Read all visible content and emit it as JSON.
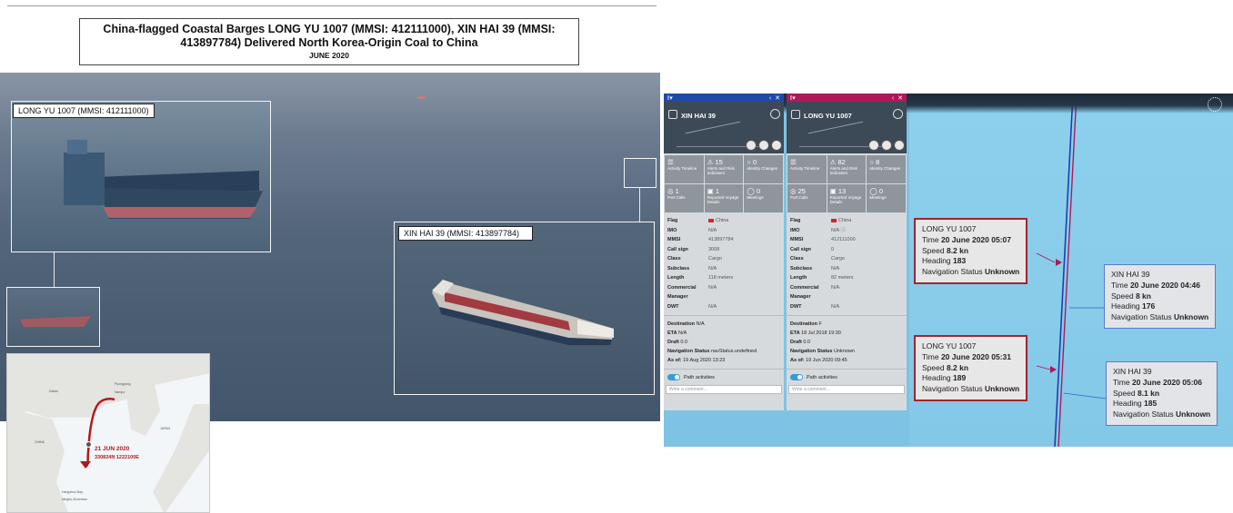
{
  "title": {
    "line1": "China-flagged Coastal Barges LONG YU 1007 (MMSI: 412111000), XIN HAI 39 (MMSI: 413897784) Delivered North Korea-Origin Coal to China",
    "line2": "JUNE 2020"
  },
  "photos": {
    "label1": "LONG YU 1007 (MMSI: 412111000)",
    "label2": "XIN HAI 39 (MMSI: 413897784)"
  },
  "map": {
    "date": "21 JUN 2020",
    "coords": "330824N 1222100E",
    "places": [
      "Dalian",
      "Nampo",
      "Pyongyang",
      "Hangzhou Bay",
      "Ningbo-Zhoushan",
      "CHINA",
      "JAPAN"
    ]
  },
  "vessel_panels": [
    {
      "name": "XIN HAI 39",
      "header_color": "#1f4aa8",
      "tiles": [
        {
          "count": "",
          "label": "Activity Timeline"
        },
        {
          "count": "15",
          "label": "Alerts and Risk Indicators"
        },
        {
          "count": "0",
          "label": "Identity Changes"
        },
        {
          "count": "1",
          "label": "Port Calls"
        },
        {
          "count": "1",
          "label": "Reported Voyage Details"
        },
        {
          "count": "0",
          "label": "Meetings"
        }
      ],
      "details": [
        {
          "k": "Flag",
          "v": "China"
        },
        {
          "k": "IMO",
          "v": "N/A"
        },
        {
          "k": "MMSI",
          "v": "413897784"
        },
        {
          "k": "Call sign",
          "v": "3008"
        },
        {
          "k": "Class",
          "v": "Cargo"
        },
        {
          "k": "Subclass",
          "v": "N/A"
        },
        {
          "k": "Length",
          "v": "118 meters"
        },
        {
          "k": "Commercial Manager",
          "v": "N/A"
        },
        {
          "k": "DWT",
          "v": "N/A"
        }
      ],
      "destination": "N/A",
      "eta": "N/A",
      "draft": "0.0",
      "nav_status": "navStatus.undefined",
      "as_of": "19 Aug 2020 13:23",
      "path_label": "Path activities",
      "comment_placeholder": "Write a comment..."
    },
    {
      "name": "LONG YU 1007",
      "header_color": "#b0185a",
      "tiles": [
        {
          "count": "",
          "label": "Activity Timeline"
        },
        {
          "count": "82",
          "label": "Alerts and Risk Indicators"
        },
        {
          "count": "8",
          "label": "Identity Changes"
        },
        {
          "count": "25",
          "label": "Port Calls"
        },
        {
          "count": "13",
          "label": "Reported Voyage Details"
        },
        {
          "count": "0",
          "label": "Meetings"
        }
      ],
      "details": [
        {
          "k": "Flag",
          "v": "China"
        },
        {
          "k": "IMO",
          "v": "N/A"
        },
        {
          "k": "MMSI",
          "v": "412111000"
        },
        {
          "k": "Call sign",
          "v": "0"
        },
        {
          "k": "Class",
          "v": "Cargo"
        },
        {
          "k": "Subclass",
          "v": "N/A"
        },
        {
          "k": "Length",
          "v": "82 meters"
        },
        {
          "k": "Commercial Manager",
          "v": "N/A"
        },
        {
          "k": "DWT",
          "v": "N/A"
        }
      ],
      "destination": "F",
      "eta": "18 Jul 2018 19:30",
      "draft": "0.0",
      "nav_status": "Unknown",
      "as_of": "19 Jun 2020 09:45",
      "path_label": "Path activities",
      "comment_placeholder": "Write a comment..."
    }
  ],
  "popups": [
    {
      "name": "LONG YU 1007",
      "time": "20 June 2020 05:07",
      "speed": "8.2 kn",
      "heading": "183",
      "status": "Unknown"
    },
    {
      "name": "XIN HAI 39",
      "time": "20 June 2020 04:46",
      "speed": "8 kn",
      "heading": "176",
      "status": "Unknown"
    },
    {
      "name": "LONG YU 1007",
      "time": "20 June 2020 05:31",
      "speed": "8.2 kn",
      "heading": "189",
      "status": "Unknown"
    },
    {
      "name": "XIN HAI 39",
      "time": "20 June 2020 05:06",
      "speed": "8.1 kn",
      "heading": "185",
      "status": "Unknown"
    }
  ],
  "labels": {
    "time": "Time",
    "speed": "Speed",
    "heading": "Heading",
    "nav_status": "Navigation Status",
    "destination": "Destination",
    "eta": "ETA",
    "draft": "Draft",
    "as_of": "As of:"
  }
}
